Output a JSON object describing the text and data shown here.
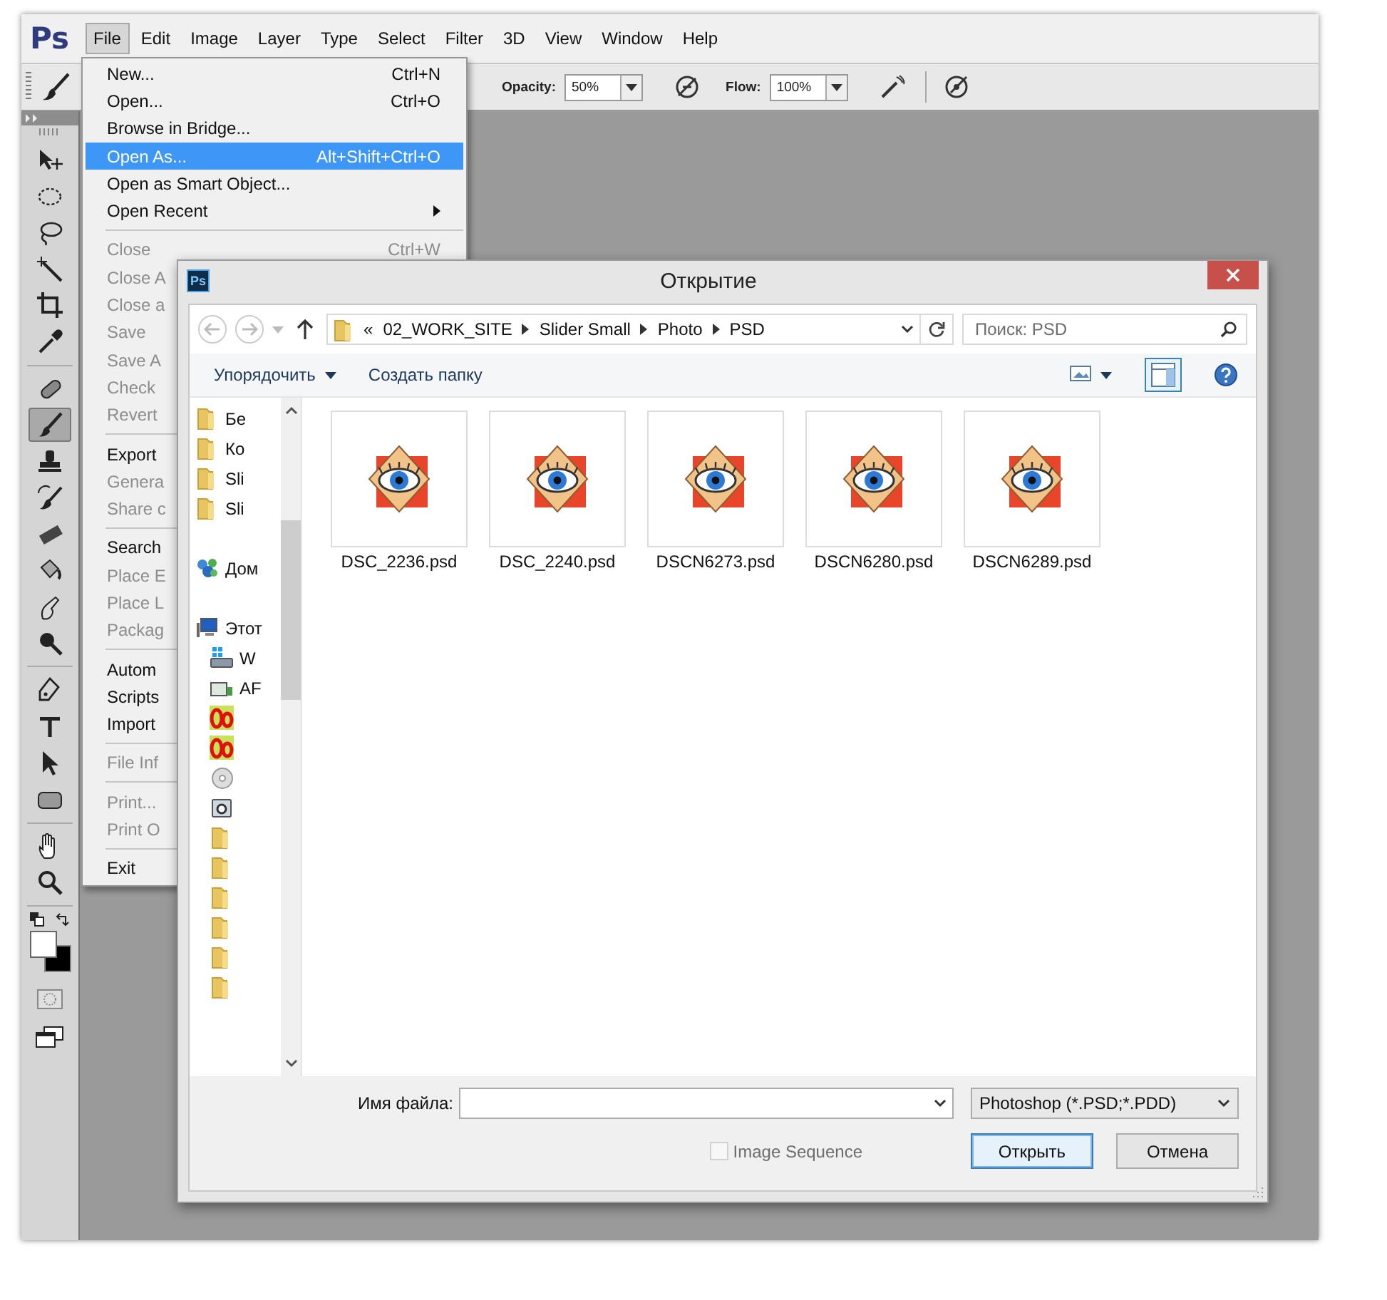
{
  "app": {
    "logo": "Ps",
    "menu_bar": [
      {
        "label": "File",
        "selected": true
      },
      {
        "label": "Edit",
        "selected": false
      },
      {
        "label": "Image",
        "selected": false
      },
      {
        "label": "Layer",
        "selected": false
      },
      {
        "label": "Type",
        "selected": false
      },
      {
        "label": "Select",
        "selected": false
      },
      {
        "label": "Filter",
        "selected": false
      },
      {
        "label": "3D",
        "selected": false
      },
      {
        "label": "View",
        "selected": false
      },
      {
        "label": "Window",
        "selected": false
      },
      {
        "label": "Help",
        "selected": false
      }
    ],
    "options_bar": {
      "opacity_label": "Opacity:",
      "opacity": "50%",
      "flow_label": "Flow:",
      "flow": "100%"
    },
    "tool_groups": [
      [
        {
          "kind": "move",
          "selected": false
        },
        {
          "kind": "marquee",
          "selected": false
        },
        {
          "kind": "lasso",
          "selected": false
        },
        {
          "kind": "wand",
          "selected": false
        },
        {
          "kind": "crop",
          "selected": false
        },
        {
          "kind": "eyedropper",
          "selected": false
        }
      ],
      [
        {
          "kind": "healing",
          "selected": false
        },
        {
          "kind": "brush",
          "selected": true
        },
        {
          "kind": "stamp",
          "selected": false
        },
        {
          "kind": "history",
          "selected": false
        },
        {
          "kind": "eraser",
          "selected": false
        },
        {
          "kind": "bucket",
          "selected": false
        },
        {
          "kind": "smudge",
          "selected": false
        },
        {
          "kind": "dodge",
          "selected": false
        }
      ],
      [
        {
          "kind": "pen",
          "selected": false
        },
        {
          "kind": "type",
          "selected": false
        },
        {
          "kind": "path-select",
          "selected": false
        },
        {
          "kind": "shape",
          "selected": false
        }
      ],
      [
        {
          "kind": "hand",
          "selected": false
        },
        {
          "kind": "zoom",
          "selected": false
        }
      ]
    ]
  },
  "file_menu": {
    "items": [
      {
        "kind": "item",
        "label": "New...",
        "shortcut": "Ctrl+N",
        "disabled": false,
        "selected": false
      },
      {
        "kind": "item",
        "label": "Open...",
        "shortcut": "Ctrl+O",
        "disabled": false,
        "selected": false
      },
      {
        "kind": "item",
        "label": "Browse in Bridge...",
        "disabled": false,
        "selected": false
      },
      {
        "kind": "item",
        "label": "Open As...",
        "shortcut": "Alt+Shift+Ctrl+O",
        "disabled": false,
        "selected": true
      },
      {
        "kind": "item",
        "label": "Open as Smart Object...",
        "disabled": false,
        "selected": false
      },
      {
        "kind": "submenu",
        "label": "Open Recent",
        "disabled": false,
        "selected": false
      },
      {
        "kind": "separator"
      },
      {
        "kind": "item",
        "label": "Close",
        "shortcut": "Ctrl+W",
        "disabled": true,
        "selected": false
      },
      {
        "kind": "item",
        "label": "Close A",
        "disabled": true,
        "selected": false
      },
      {
        "kind": "item",
        "label": "Close a",
        "disabled": true,
        "selected": false
      },
      {
        "kind": "item",
        "label": "Save",
        "disabled": true,
        "selected": false
      },
      {
        "kind": "item",
        "label": "Save A",
        "disabled": true,
        "selected": false
      },
      {
        "kind": "item",
        "label": "Check",
        "disabled": true,
        "selected": false
      },
      {
        "kind": "item",
        "label": "Revert",
        "disabled": true,
        "selected": false
      },
      {
        "kind": "separator"
      },
      {
        "kind": "item",
        "label": "Export",
        "disabled": false,
        "selected": false
      },
      {
        "kind": "item",
        "label": "Genera",
        "disabled": true,
        "selected": false
      },
      {
        "kind": "item",
        "label": "Share c",
        "disabled": true,
        "selected": false
      },
      {
        "kind": "separator"
      },
      {
        "kind": "item",
        "label": "Search",
        "disabled": false,
        "selected": false
      },
      {
        "kind": "item",
        "label": "Place E",
        "disabled": true,
        "selected": false
      },
      {
        "kind": "item",
        "label": "Place L",
        "disabled": true,
        "selected": false
      },
      {
        "kind": "item",
        "label": "Packag",
        "disabled": true,
        "selected": false
      },
      {
        "kind": "separator"
      },
      {
        "kind": "item",
        "label": "Autom",
        "disabled": false,
        "selected": false
      },
      {
        "kind": "item",
        "label": "Scripts",
        "disabled": false,
        "selected": false
      },
      {
        "kind": "item",
        "label": "Import",
        "disabled": false,
        "selected": false
      },
      {
        "kind": "separator"
      },
      {
        "kind": "item",
        "label": "File Inf",
        "disabled": true,
        "selected": false
      },
      {
        "kind": "separator"
      },
      {
        "kind": "item",
        "label": "Print...",
        "disabled": true,
        "selected": false
      },
      {
        "kind": "item",
        "label": "Print O",
        "disabled": true,
        "selected": false
      },
      {
        "kind": "separator"
      },
      {
        "kind": "item",
        "label": "Exit",
        "disabled": false,
        "selected": false
      }
    ]
  },
  "dialog": {
    "app_icon": "Ps",
    "title": "Открытие",
    "address_bar": {
      "overflow": "«",
      "segments": [
        "02_WORK_SITE",
        "Slider Small",
        "Photo",
        "PSD"
      ]
    },
    "search": {
      "placeholder": "Поиск: PSD"
    },
    "command_bar": {
      "organize": "Упорядочить",
      "new_folder": "Создать папку",
      "view_buttons": [
        {
          "kind": "view-menu",
          "selected": false
        },
        {
          "kind": "preview-pane",
          "selected": true
        },
        {
          "kind": "help",
          "selected": false
        }
      ]
    },
    "navigation": [
      {
        "kind": "folder",
        "label": "Бе"
      },
      {
        "kind": "folder",
        "label": "Ко"
      },
      {
        "kind": "folder",
        "label": "Sli"
      },
      {
        "kind": "folder",
        "label": "Sli"
      },
      {
        "kind": "network",
        "label": "Дом"
      },
      {
        "kind": "computer",
        "label": "Этот",
        "children": [
          {
            "kind": "system-drive",
            "label": "W"
          },
          {
            "kind": "drive",
            "label": "AF"
          },
          {
            "kind": "red-drive"
          },
          {
            "kind": "red-drive"
          },
          {
            "kind": "disc"
          },
          {
            "kind": "camera"
          },
          {
            "kind": "folder"
          },
          {
            "kind": "folder"
          },
          {
            "kind": "folder"
          },
          {
            "kind": "folder"
          },
          {
            "kind": "folder"
          },
          {
            "kind": "folder"
          }
        ]
      }
    ],
    "files": [
      {
        "name": "DSC_2236.psd"
      },
      {
        "name": "DSC_2240.psd"
      },
      {
        "name": "DSCN6273.psd"
      },
      {
        "name": "DSCN6280.psd"
      },
      {
        "name": "DSCN6289.psd"
      }
    ],
    "footer": {
      "file_name_label": "Имя файла:",
      "file_type": "Photoshop (*.PSD;*.PDD)",
      "image_sequence": {
        "label": "Image Sequence",
        "checked": false,
        "disabled": true
      },
      "buttons": [
        {
          "label": "Открыть",
          "default": true
        },
        {
          "label": "Отмена",
          "default": false
        }
      ]
    }
  }
}
